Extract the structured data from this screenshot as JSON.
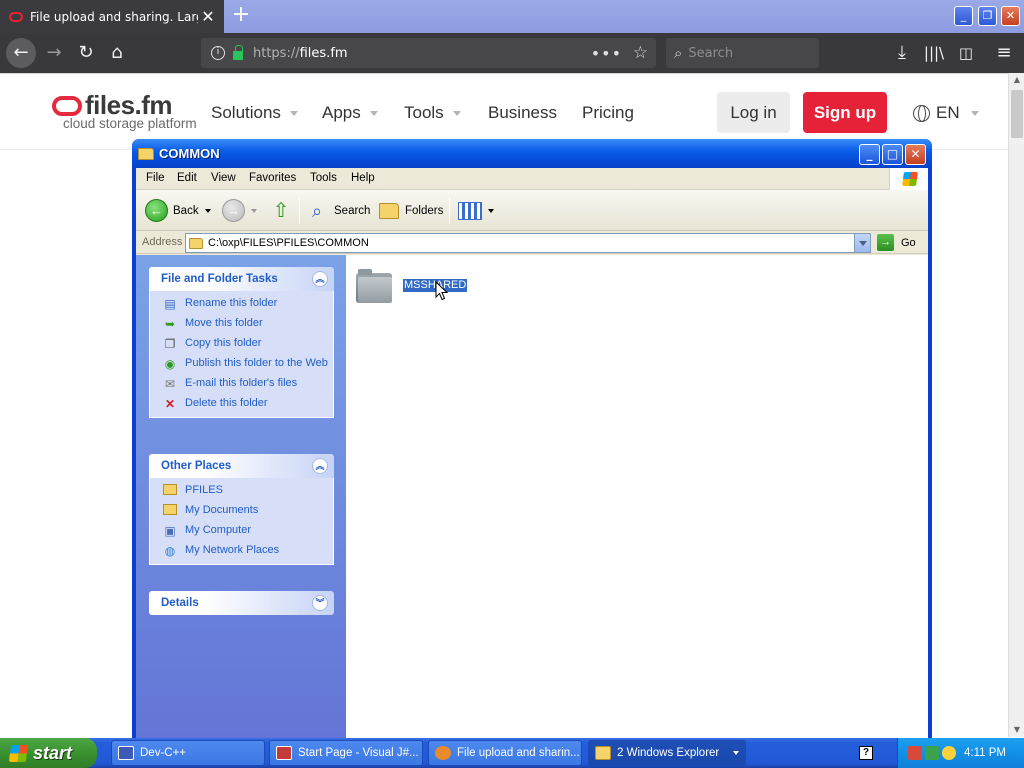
{
  "browser": {
    "tab": {
      "title": "File upload and sharing. Large file"
    },
    "url": {
      "protocol": "https://",
      "host": "files.fm"
    },
    "search_placeholder": "Search"
  },
  "site": {
    "logo": {
      "brand": "files.fm",
      "tagline": "cloud storage platform"
    },
    "nav": [
      {
        "label": "Solutions"
      },
      {
        "label": "Apps"
      },
      {
        "label": "Tools"
      },
      {
        "label": "Business"
      },
      {
        "label": "Pricing"
      }
    ],
    "login_label": "Log in",
    "signup_label": "Sign up",
    "language": "EN",
    "colors": {
      "accent": "#e52238"
    }
  },
  "explorer": {
    "title": "COMMON",
    "menu": [
      "File",
      "Edit",
      "View",
      "Favorites",
      "Tools",
      "Help"
    ],
    "toolbar": {
      "back": "Back",
      "search": "Search",
      "folders": "Folders"
    },
    "address": {
      "label": "Address",
      "path": "C:\\oxp\\FILES\\PFILES\\COMMON",
      "go": "Go"
    },
    "tasks": {
      "title": "File and Folder Tasks",
      "items": [
        {
          "label": "Rename this folder",
          "icon": "rename-icon"
        },
        {
          "label": "Move this folder",
          "icon": "move-icon"
        },
        {
          "label": "Copy this folder",
          "icon": "copy-icon"
        },
        {
          "label": "Publish this folder to the Web",
          "icon": "publish-icon"
        },
        {
          "label": "E-mail this folder's files",
          "icon": "email-icon"
        },
        {
          "label": "Delete this folder",
          "icon": "delete-icon"
        }
      ]
    },
    "places": {
      "title": "Other Places",
      "items": [
        {
          "label": "PFILES",
          "icon": "folder-icon"
        },
        {
          "label": "My Documents",
          "icon": "my-documents-icon"
        },
        {
          "label": "My Computer",
          "icon": "my-computer-icon"
        },
        {
          "label": "My Network Places",
          "icon": "network-icon"
        }
      ]
    },
    "details_title": "Details",
    "files": [
      {
        "name": "MSSHARED",
        "selected": true
      }
    ]
  },
  "taskbar": {
    "start": "start",
    "items": [
      {
        "label": "Dev-C++"
      },
      {
        "label": "Start Page - Visual J#..."
      },
      {
        "label": "File upload and sharin..."
      },
      {
        "label": "2 Windows Explorer"
      }
    ],
    "clock": "4:11 PM"
  }
}
